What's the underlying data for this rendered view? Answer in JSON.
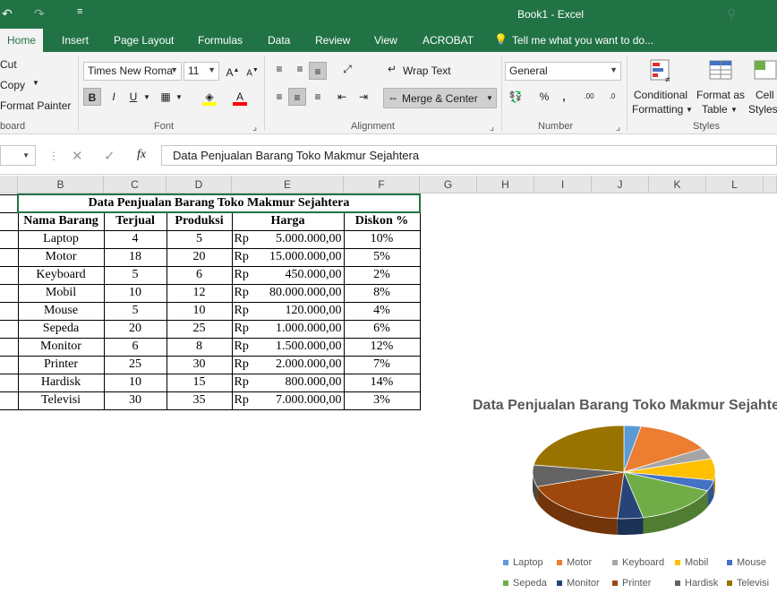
{
  "app": {
    "window_title": "Book1 - Excel"
  },
  "tabs": [
    "Home",
    "Insert",
    "Page Layout",
    "Formulas",
    "Data",
    "Review",
    "View",
    "ACROBAT"
  ],
  "tell_me": "Tell me what you want to do...",
  "clipboard": {
    "cut": "Cut",
    "copy": "Copy",
    "format_painter": "Format Painter",
    "group": "board"
  },
  "font": {
    "name": "Times New Roma",
    "size": "11",
    "group": "Font",
    "bold": "B",
    "italic": "I",
    "underline": "U"
  },
  "alignment": {
    "wrap_text": "Wrap Text",
    "merge_center": "Merge & Center",
    "group": "Alignment"
  },
  "number": {
    "format": "General",
    "percent": "%",
    "comma": ",",
    "group": "Number"
  },
  "styles": {
    "conditional": "Conditional",
    "formatting": "Formatting",
    "format_as": "Format as",
    "table": "Table",
    "cell": "Cell",
    "cell_styles": "Styles",
    "group": "Styles"
  },
  "formula_bar": {
    "fx": "fx",
    "content": "Data Penjualan Barang Toko Makmur Sejahtera"
  },
  "columns": [
    "B",
    "C",
    "D",
    "E",
    "F",
    "G",
    "H",
    "I",
    "J",
    "K",
    "L"
  ],
  "table": {
    "title": "Data Penjualan Barang Toko Makmur Sejahtera",
    "headers": [
      "Nama Barang",
      "Terjual",
      "Produksi",
      "Harga",
      "Diskon %"
    ],
    "currency": "Rp",
    "rows": [
      [
        "Laptop",
        "4",
        "5",
        "5.000.000,00",
        "10%"
      ],
      [
        "Motor",
        "18",
        "20",
        "15.000.000,00",
        "5%"
      ],
      [
        "Keyboard",
        "5",
        "6",
        "450.000,00",
        "2%"
      ],
      [
        "Mobil",
        "10",
        "12",
        "80.000.000,00",
        "8%"
      ],
      [
        "Mouse",
        "5",
        "10",
        "120.000,00",
        "4%"
      ],
      [
        "Sepeda",
        "20",
        "25",
        "1.000.000,00",
        "6%"
      ],
      [
        "Monitor",
        "6",
        "8",
        "1.500.000,00",
        "12%"
      ],
      [
        "Printer",
        "25",
        "30",
        "2.000.000,00",
        "7%"
      ],
      [
        "Hardisk",
        "10",
        "15",
        "800.000,00",
        "14%"
      ],
      [
        "Televisi",
        "30",
        "35",
        "7.000.000,00",
        "3%"
      ]
    ]
  },
  "chart_data": {
    "type": "pie",
    "title": "Data Penjualan Barang Toko Makmur Sejahtera",
    "categories": [
      "Laptop",
      "Motor",
      "Keyboard",
      "Mobil",
      "Mouse",
      "Sepeda",
      "Monitor",
      "Printer",
      "Hardisk",
      "Televisi"
    ],
    "values": [
      4,
      18,
      5,
      10,
      5,
      20,
      6,
      25,
      10,
      30
    ],
    "colors": [
      "#5b9bd5",
      "#ed7d31",
      "#a5a5a5",
      "#ffc000",
      "#4472c4",
      "#70ad47",
      "#264478",
      "#9e480e",
      "#636363",
      "#997300"
    ],
    "legend": "bottom"
  }
}
